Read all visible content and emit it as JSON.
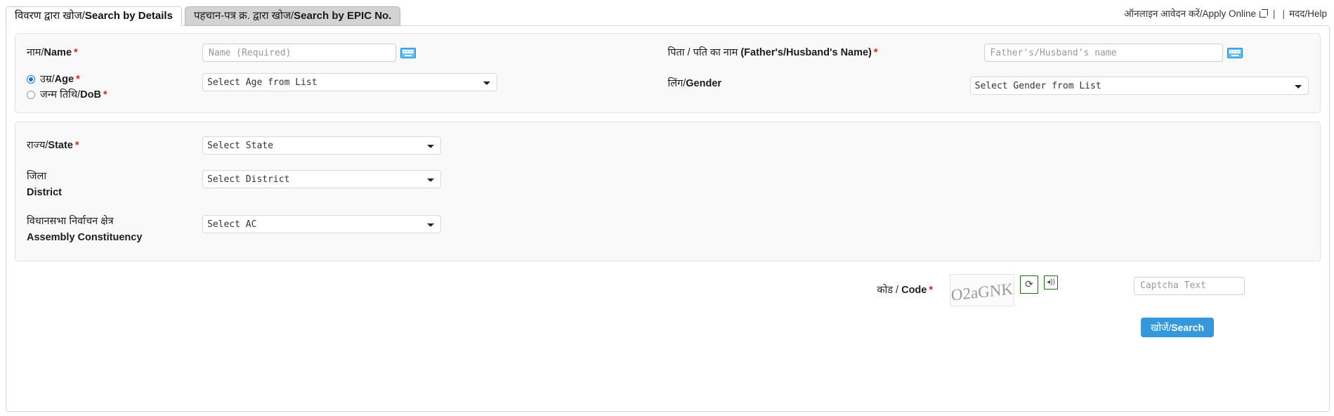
{
  "tabs": [
    {
      "hi": "विवरण द्वारा खोज/",
      "en": "Search by Details",
      "active": true
    },
    {
      "hi": "पहचान-पत्र क्र. द्वारा खोज/",
      "en": "Search by EPIC No.",
      "active": false
    }
  ],
  "toplinks": {
    "apply_online": "ऑनलाइन आवेदन करें/Apply Online",
    "separator": "|",
    "help": "मदद/Help"
  },
  "personal": {
    "name_label_hi": "नाम/",
    "name_label_en": "Name",
    "name_placeholder": "Name (Required)",
    "name_value": "",
    "father_label_hi": "पिता / पति का नाम ",
    "father_label_en": "(Father's/Husband's Name)",
    "father_placeholder": "Father's/Husband's name",
    "father_value": "",
    "age_label_hi": "उम्र/",
    "age_label_en": "Age",
    "dob_label_hi": "जन्म तिथि/",
    "dob_label_en": "DoB",
    "age_select_value": "Select Age from List",
    "gender_label_hi": "लिंग/",
    "gender_label_en": "Gender",
    "gender_select_value": "Select Gender from List",
    "age_mode": "age"
  },
  "location": {
    "state_label_hi": "राज्य/",
    "state_label_en": "State",
    "state_select_value": "Select State",
    "district_label_hi": "जिला",
    "district_label_en": "District",
    "district_select_value": "Select District",
    "ac_label_hi": "विधानसभा निर्वाचन क्षेत्र",
    "ac_label_en": "Assembly Constituency",
    "ac_select_value": "Select AC"
  },
  "captcha": {
    "label_hi": "कोड / ",
    "label_en": "Code",
    "image_text": "O2aGNK",
    "refresh_glyph": "⟳",
    "audio_glyph": "◂))",
    "input_placeholder": "Captcha Text",
    "input_value": ""
  },
  "submit": {
    "label_hi": "खोजें/",
    "label_en": "Search"
  },
  "colors": {
    "accent_blue": "#3498db",
    "required_red": "#e2231a",
    "captcha_button_green": "#1b6b1b",
    "keyboard_icon_blue": "#5cc0f5"
  }
}
